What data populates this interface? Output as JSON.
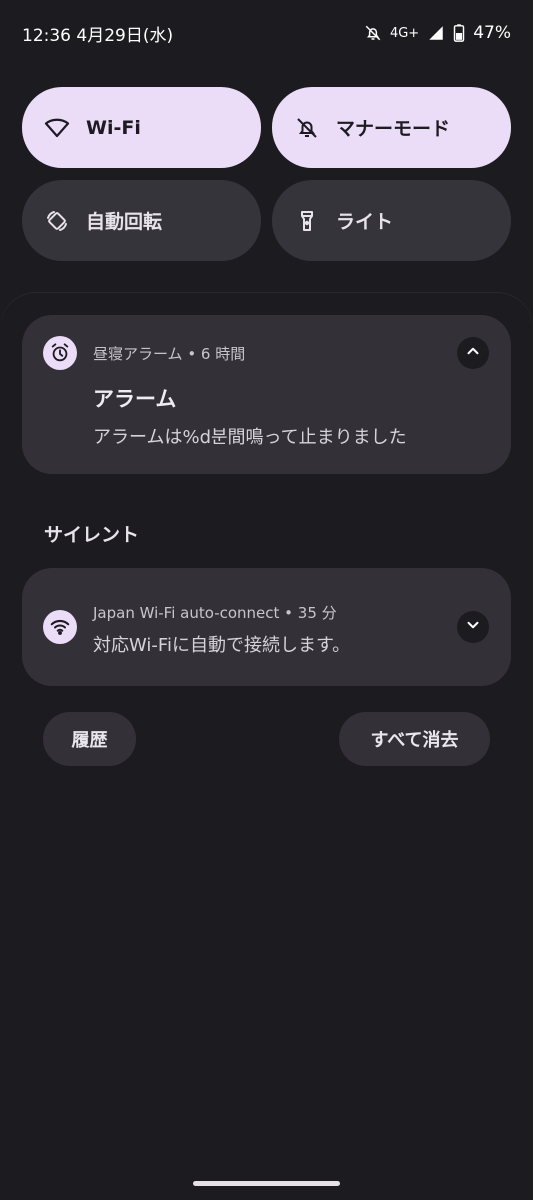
{
  "status_bar": {
    "time": "12:36",
    "date": "4月29日(水)",
    "network": "4G+",
    "battery": "47%",
    "icons": [
      "bell-off-icon",
      "signal-icon",
      "battery-icon"
    ]
  },
  "quick_tiles": [
    {
      "label": "Wi-Fi",
      "icon": "wifi-icon",
      "active": true
    },
    {
      "label": "マナーモード",
      "icon": "bell-off-icon",
      "active": true
    },
    {
      "label": "自動回転",
      "icon": "rotate-icon",
      "active": false
    },
    {
      "label": "ライト",
      "icon": "flashlight-icon",
      "active": false
    }
  ],
  "notifications": {
    "alarm": {
      "app": "昼寝アラーム",
      "time_ago": "6 時間",
      "header": "昼寝アラーム • 6 時間",
      "title": "アラーム",
      "text": "アラームは%d분間鳴って止まりました",
      "expanded": true
    },
    "section_silent": "サイレント",
    "wifi": {
      "app": "Japan Wi-Fi auto-connect",
      "time_ago": "35 分",
      "header": "Japan Wi-Fi auto-connect • 35 分",
      "text": "対応Wi-Fiに自動で接続します。",
      "expanded": false
    }
  },
  "buttons": {
    "history": "履歴",
    "clear_all": "すべて消去"
  },
  "colors": {
    "background": "#1c1b1f",
    "tile_active": "#ebdcf8",
    "tile_inactive": "#36343b",
    "card": "#333137"
  }
}
